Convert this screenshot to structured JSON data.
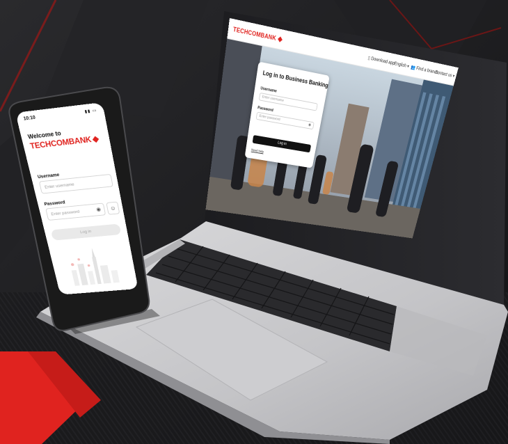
{
  "colors": {
    "brand_red": "#e0231f",
    "background": "#1b1b1d",
    "laptop_body": "#c9c9cc",
    "phone_frame": "#1a1a1a",
    "login_button": "#111111"
  },
  "laptop": {
    "navbar": {
      "logo_text": "TECHCOMBANK",
      "download_app": "Download app",
      "language": "English",
      "find_branch": "Find a branch",
      "contact": "Contact us"
    },
    "login_card": {
      "title": "Log in to Business Banking",
      "username_label": "Username",
      "username_placeholder": "Enter username",
      "password_label": "Password",
      "password_placeholder": "Enter password",
      "login_button": "Log in",
      "help_link": "Need help"
    }
  },
  "phone": {
    "status_time": "10:10",
    "welcome": "Welcome to",
    "brand": "TECHCOMBANK",
    "username_label": "Username",
    "username_placeholder": "Enter username",
    "password_label": "Password",
    "password_placeholder": "Enter password",
    "login_button": "Log in"
  },
  "icons": {
    "brand_mark": "techcombank-diamond-logo",
    "download": "phone-icon",
    "branch": "people-icon",
    "eye": "eye-icon",
    "face_id": "face-id-icon"
  }
}
